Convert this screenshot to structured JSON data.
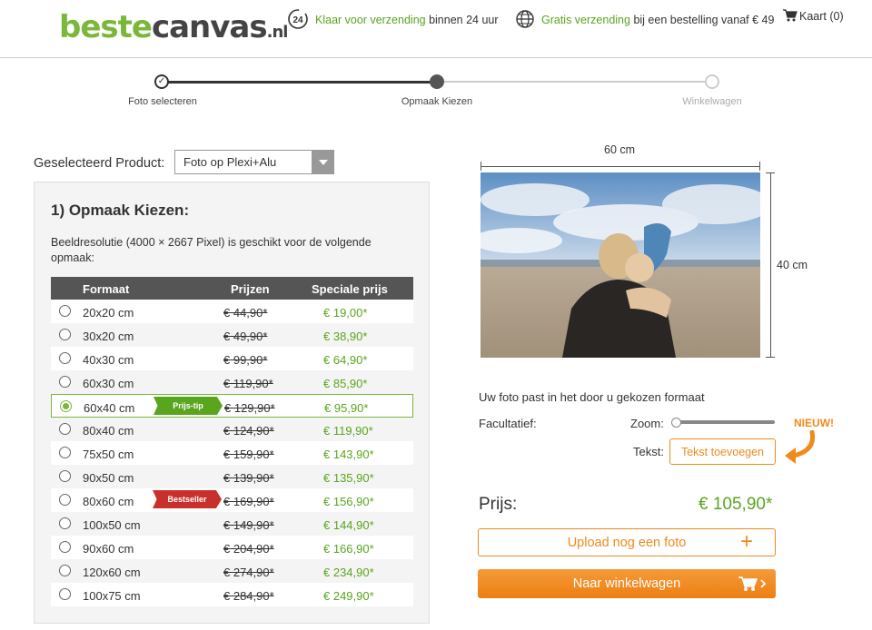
{
  "header": {
    "logo": {
      "part1": "beste",
      "part2": "canvas",
      "part3": ".nl"
    },
    "delivery": {
      "badge": "24",
      "highlight": "Klaar voor verzending",
      "rest": " binnen 24 uur"
    },
    "shipping": {
      "highlight": "Gratis verzending",
      "rest": " bij een bestelling vanaf € 49"
    },
    "cart": {
      "label": "Kaart (0)"
    }
  },
  "steps": [
    {
      "label": "Foto selecteren",
      "state": "done",
      "mark": "✓"
    },
    {
      "label": "Opmaak Kiezen",
      "state": "active"
    },
    {
      "label": "Winkelwagen",
      "state": "todo"
    }
  ],
  "product": {
    "label": "Geselecteerd Product:",
    "selected": "Foto op Plexi+Alu"
  },
  "panel": {
    "title": "1) Opmaak Kiezen:",
    "description": "Beeldresolutie (4000 × 2667 Pixel) is geschikt voor de volgende opmaak:",
    "columns": [
      "Formaat",
      "Prijzen",
      "Speciale prijs"
    ],
    "rows": [
      {
        "size": "20x20 cm",
        "old": "€ 44,90*",
        "new": "€ 19,00*"
      },
      {
        "size": "30x20 cm",
        "old": "€ 49,90*",
        "new": "€ 38,90*"
      },
      {
        "size": "40x30 cm",
        "old": "€ 99,90*",
        "new": "€ 64,90*"
      },
      {
        "size": "60x30 cm",
        "old": "€ 119,90*",
        "new": "€ 85,90*"
      },
      {
        "size": "60x40 cm",
        "old": "€ 129,90*",
        "new": "€ 95,90*"
      },
      {
        "size": "80x40 cm",
        "old": "€ 124,90*",
        "new": "€ 119,90*"
      },
      {
        "size": "75x50 cm",
        "old": "€ 159,90*",
        "new": "€ 143,90*"
      },
      {
        "size": "90x50 cm",
        "old": "€ 139,90*",
        "new": "€ 135,90*"
      },
      {
        "size": "80x60 cm",
        "old": "€ 169,90*",
        "new": "€ 156,90*"
      },
      {
        "size": "100x50 cm",
        "old": "€ 149,90*",
        "new": "€ 144,90*"
      },
      {
        "size": "90x60 cm",
        "old": "€ 204,90*",
        "new": "€ 166,90*"
      },
      {
        "size": "120x60 cm",
        "old": "€ 274,90*",
        "new": "€ 234,90*"
      },
      {
        "size": "100x75 cm",
        "old": "€ 284,90*",
        "new": "€ 249,90*"
      }
    ],
    "selected_row": 4,
    "ribbons": [
      {
        "row": 4,
        "text": "Prijs-tip",
        "color": "#5aa51e"
      },
      {
        "row": 8,
        "text": "Bestseller",
        "color": "#c9302c"
      }
    ]
  },
  "preview": {
    "width_label": "60 cm",
    "height_label": "40 cm",
    "fit_text": "Uw foto past in het door u gekozen formaat",
    "optional_label": "Facultatief:",
    "zoom_label": "Zoom:",
    "zoom_value": 0,
    "new_badge": "NIEUW!",
    "text_label": "Tekst:",
    "text_button": "Tekst toevoegen"
  },
  "price": {
    "label": "Prijs:",
    "value": "€ 105,90*"
  },
  "actions": {
    "upload": "Upload nog een foto",
    "cart": "Naar winkelwagen"
  },
  "colors": {
    "brand_green": "#7ab73b",
    "accent_orange": "#f08a1c",
    "dark": "#555555"
  }
}
